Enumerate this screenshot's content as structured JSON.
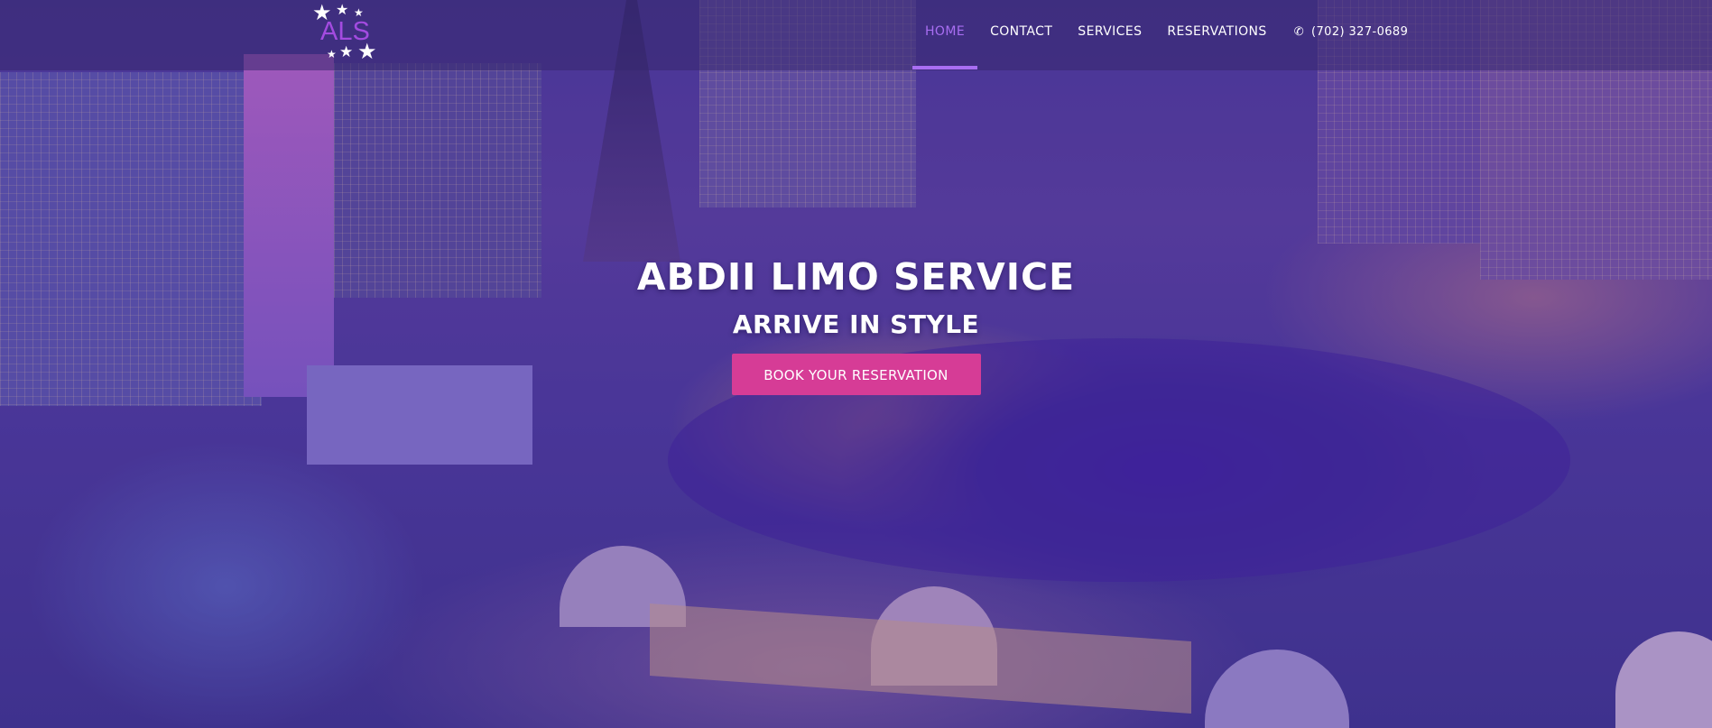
{
  "logo": {
    "text": "ALS",
    "star_glyph": "★"
  },
  "nav": {
    "items": [
      {
        "label": "HOME",
        "active": true
      },
      {
        "label": "CONTACT",
        "active": false
      },
      {
        "label": "SERVICES",
        "active": false
      },
      {
        "label": "RESERVATIONS",
        "active": false
      }
    ],
    "phone": "(702) 327-0689",
    "phone_icon": "phone-icon"
  },
  "hero": {
    "title": "ABDII LIMO SERVICE",
    "subtitle": "ARRIVE IN STYLE",
    "cta_label": "BOOK YOUR RESERVATION"
  },
  "colors": {
    "accent": "#a86ef2",
    "cta": "#d63c96",
    "overlay": "#462da0"
  }
}
